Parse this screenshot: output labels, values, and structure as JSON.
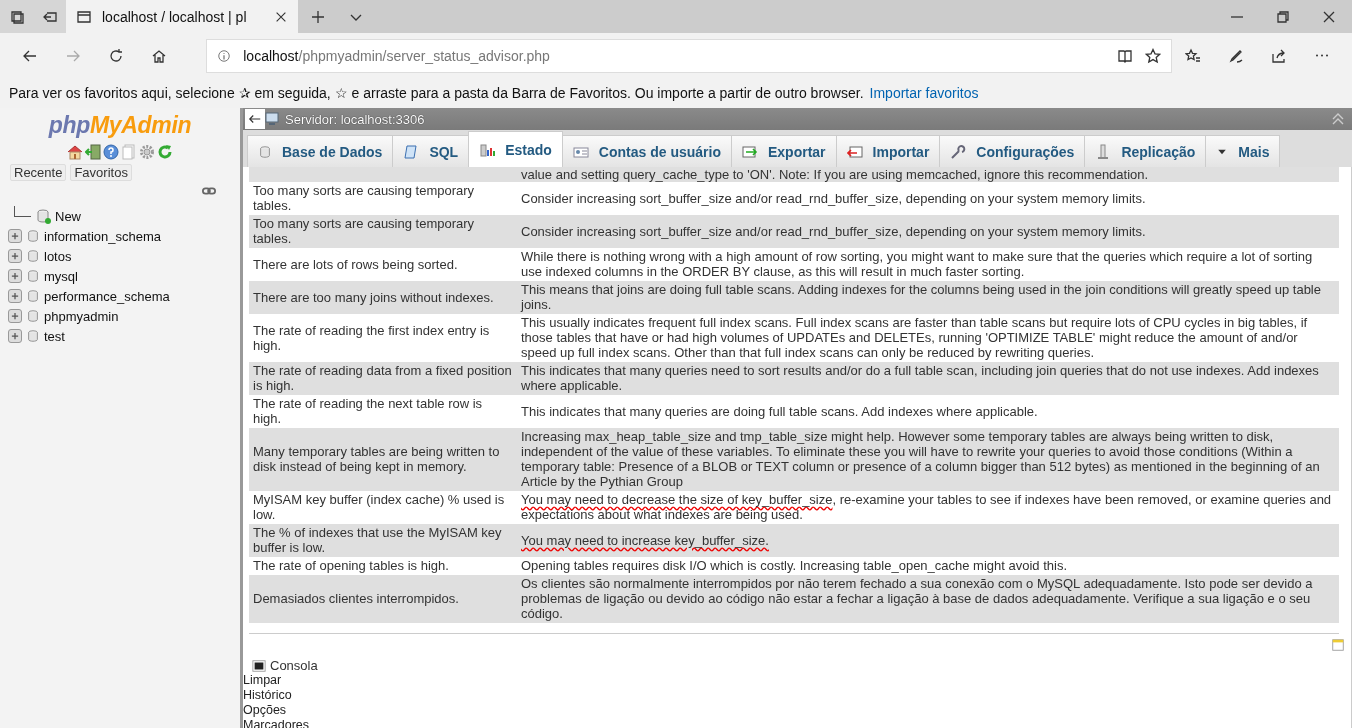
{
  "browser": {
    "tab_title": "localhost / localhost | pl",
    "url_host": "localhost",
    "url_path": "/phpmyadmin/server_status_advisor.php",
    "favorites_hint": "Para ver os favoritos aqui, selecione ✰ em seguida, ☆ e arraste para a pasta da Barra de Favoritos. Ou importe a partir de outro browser.",
    "favorites_link": "Importar favoritos"
  },
  "navigation": {
    "logo_php": "php",
    "logo_myadmin": "MyAdmin",
    "buttons": [
      "Recente",
      "Favoritos"
    ],
    "tree": [
      {
        "label": "New",
        "kind": "new"
      },
      {
        "label": "information_schema",
        "kind": "database"
      },
      {
        "label": "lotos",
        "kind": "database"
      },
      {
        "label": "mysql",
        "kind": "database"
      },
      {
        "label": "performance_schema",
        "kind": "database"
      },
      {
        "label": "phpmyadmin",
        "kind": "database"
      },
      {
        "label": "test",
        "kind": "database"
      }
    ]
  },
  "server_bar": {
    "title": "Servidor: localhost:3306"
  },
  "tabs": [
    {
      "label": "Base de Dados",
      "kind": "database",
      "selected": false
    },
    {
      "label": "SQL",
      "kind": "sql",
      "selected": false
    },
    {
      "label": "Estado",
      "kind": "status",
      "selected": true
    },
    {
      "label": "Contas de usuário",
      "kind": "users",
      "selected": false
    },
    {
      "label": "Exportar",
      "kind": "export",
      "selected": false
    },
    {
      "label": "Importar",
      "kind": "import",
      "selected": false
    },
    {
      "label": "Configurações",
      "kind": "settings",
      "selected": false
    },
    {
      "label": "Replicação",
      "kind": "replication",
      "selected": false
    },
    {
      "label": "Mais",
      "kind": "more",
      "selected": false
    }
  ],
  "advisor_rows": [
    {
      "recommendation": "value and setting query_cache_type to 'ON'. Note: If you are using memcached, ignore this recommendation."
    },
    {
      "issue": "Too many sorts are causing temporary tables.",
      "recommendation": "Consider increasing sort_buffer_size and/or read_rnd_buffer_size, depending on your system memory limits."
    },
    {
      "issue": "Too many sorts are causing temporary tables.",
      "recommendation": "Consider increasing sort_buffer_size and/or read_rnd_buffer_size, depending on your system memory limits."
    },
    {
      "issue": "There are lots of rows being sorted.",
      "recommendation": "While there is nothing wrong with a high amount of row sorting, you might want to make sure that the queries which require a lot of sorting use indexed columns in the ORDER BY clause, as this will result in much faster sorting."
    },
    {
      "issue": "There are too many joins without indexes.",
      "recommendation": "This means that joins are doing full table scans. Adding indexes for the columns being used in the join conditions will greatly speed up table joins."
    },
    {
      "issue": "The rate of reading the first index entry is high.",
      "recommendation": "This usually indicates frequent full index scans. Full index scans are faster than table scans but require lots of CPU cycles in big tables, if those tables that have or had high volumes of UPDATEs and DELETEs, running 'OPTIMIZE TABLE' might reduce the amount of and/or speed up full index scans. Other than that full index scans can only be reduced by rewriting queries."
    },
    {
      "issue": "The rate of reading data from a fixed position is high.",
      "recommendation": "This indicates that many queries need to sort results and/or do a full table scan, including join queries that do not use indexes. Add indexes where applicable."
    },
    {
      "issue": "The rate of reading the next table row is high.",
      "recommendation": "This indicates that many queries are doing full table scans. Add indexes where applicable."
    },
    {
      "issue": "Many temporary tables are being written to disk instead of being kept in memory.",
      "recommendation": "Increasing max_heap_table_size and tmp_table_size might help. However some temporary tables are always being written to disk, independent of the value of these variables. To eliminate these you will have to rewrite your queries to avoid those conditions (Within a temporary table: Presence of a BLOB or TEXT column or presence of a column bigger than 512 bytes) as mentioned in the beginning of an Article by the Pythian Group"
    },
    {
      "issue": "MyISAM key buffer (index cache) % used is low.",
      "parts": [
        {
          "text": "You may need to decrease the size of key_buffer_size",
          "underlined": true
        },
        {
          "text": ", re-examine your tables to see if indexes have been removed, or examine queries and expectations about what indexes are being used.",
          "underlined": false
        }
      ]
    },
    {
      "issue": "The % of indexes that use the MyISAM key buffer is low.",
      "parts": [
        {
          "text": "You may need to increase key_buffer_size.",
          "underlined": true
        }
      ]
    },
    {
      "issue": "The rate of opening tables is high.",
      "recommendation": "Opening tables requires disk I/O which is costly. Increasing table_open_cache might avoid this."
    },
    {
      "issue": "Demasiados clientes interrompidos.",
      "recommendation": "Os clientes são normalmente interrompidos por não terem fechado a sua conexão com o MySQL adequadamente. Isto pode ser devido a problemas de ligação ou devido ao código não estar a fechar a ligação à base de dados adequadamente. Verifique a sua ligação e o seu código."
    }
  ],
  "console": {
    "title": "Consola",
    "links": [
      "Limpar",
      "Histórico",
      "Opções",
      "Marcadores"
    ]
  }
}
